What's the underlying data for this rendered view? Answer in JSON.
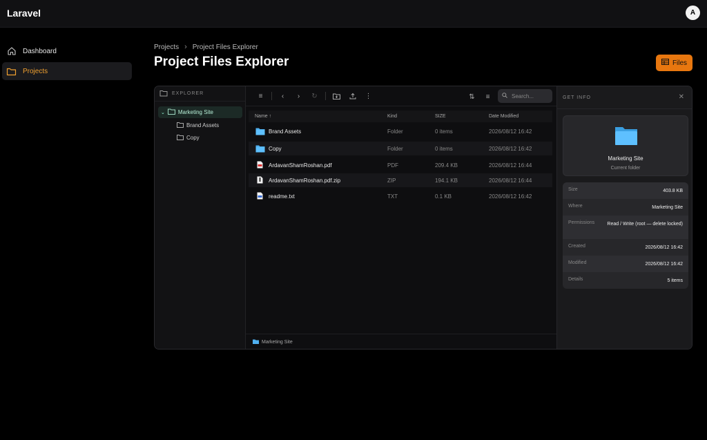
{
  "app": {
    "brand": "Laravel",
    "avatar_initial": "A"
  },
  "sidebar": {
    "items": [
      {
        "label": "Dashboard",
        "icon": "home-icon"
      },
      {
        "label": "Projects",
        "icon": "folder-icon"
      }
    ]
  },
  "breadcrumb": {
    "items": [
      "Projects",
      "Project Files Explorer"
    ]
  },
  "page": {
    "title": "Project Files Explorer",
    "files_button": "Files"
  },
  "explorer": {
    "header": "EXPLORER",
    "tree": {
      "root": "Marketing Site",
      "children": [
        "Brand Assets",
        "Copy"
      ]
    }
  },
  "toolbar": {
    "search_placeholder": "Search..."
  },
  "table": {
    "headers": {
      "name": "Name ↑",
      "kind": "Kind",
      "size": "SIZE",
      "date": "Date Modified"
    },
    "rows": [
      {
        "name": "Brand Assets",
        "kind": "Folder",
        "size": "0 items",
        "date": "2026/08/12 16:42",
        "icon": "folder-icon"
      },
      {
        "name": "Copy",
        "kind": "Folder",
        "size": "0 items",
        "date": "2026/08/12 16:42",
        "icon": "folder-icon"
      },
      {
        "name": "ArdavanShamRoshan.pdf",
        "kind": "PDF",
        "size": "209.4 KB",
        "date": "2026/08/12 16:44",
        "icon": "pdf-file-icon"
      },
      {
        "name": "ArdavanShamRoshan.pdf.zip",
        "kind": "ZIP",
        "size": "194.1 KB",
        "date": "2026/08/12 16:44",
        "icon": "zip-file-icon"
      },
      {
        "name": "readme.txt",
        "kind": "TXT",
        "size": "0.1 KB",
        "date": "2026/08/12 16:42",
        "icon": "text-file-icon"
      }
    ]
  },
  "status_bar": {
    "path": "Marketing Site"
  },
  "info_panel": {
    "header": "GET INFO",
    "card": {
      "title": "Marketing Site",
      "subtitle": "Current folder"
    },
    "rows": [
      {
        "key": "Size",
        "value": "403.8 KB"
      },
      {
        "key": "Where",
        "value": "Marketing Site"
      },
      {
        "key": "Permissions",
        "value": "Read / Write (root — delete locked)"
      },
      {
        "key": "Created",
        "value": "2026/08/12 16:42"
      },
      {
        "key": "Modified",
        "value": "2026/08/12 16:42"
      },
      {
        "key": "Details",
        "value": "5 items"
      }
    ]
  },
  "colors": {
    "accent": "#e8770f",
    "active_nav": "#f0a030",
    "folder": "#4fb0f0",
    "tree_active": "#b8f0d8"
  }
}
